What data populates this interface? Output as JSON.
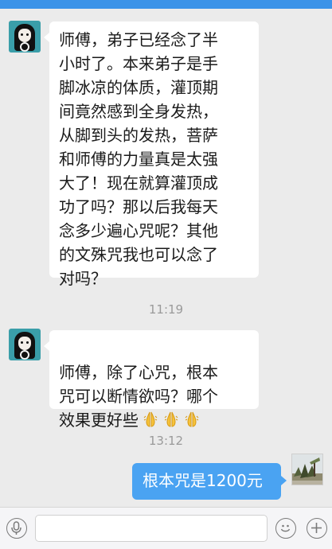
{
  "colors": {
    "status_bar": "#3c93e8",
    "background": "#ebebeb",
    "incoming_bubble": "#ffffff",
    "outgoing_bubble": "#4aa3f2",
    "timestamp_text": "#9a9a9a"
  },
  "messages": [
    {
      "direction": "incoming",
      "avatar_icon": "girl-avatar-icon",
      "text": "师傅，弟子已经念了半\n小时了。本来弟子是手\n脚冰凉的体质，灌顶期\n间竟然感到全身发热，\n从脚到头的发热，菩萨\n和师傅的力量真是太强\n大了！现在就算灌顶成\n功了吗？那以后我每天\n念多少遍心咒呢？其他\n的文殊咒我也可以念了\n对吗？"
    },
    {
      "direction": "incoming",
      "avatar_icon": "girl-avatar-icon",
      "text": "师傅，除了心咒，根本\n咒可以断情欲吗？哪个\n效果更好些",
      "emoji": [
        "praying-hands-icon",
        "praying-hands-icon",
        "praying-hands-icon"
      ]
    },
    {
      "direction": "outgoing",
      "avatar_icon": "landscape-avatar-icon",
      "text": "根本咒是1200元"
    }
  ],
  "timestamps": [
    "11:19",
    "13:12"
  ],
  "input_bar": {
    "voice_icon": "microphone-icon",
    "text_value": "",
    "emoji_icon": "smiley-icon",
    "more_icon": "plus-icon"
  }
}
